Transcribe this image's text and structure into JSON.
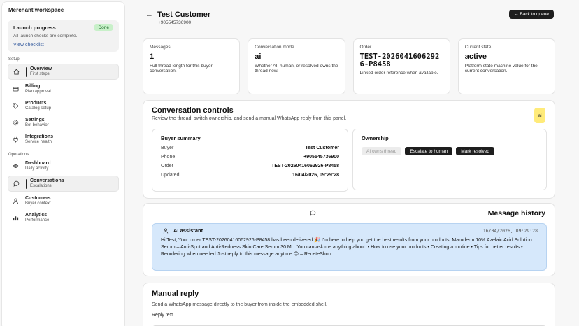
{
  "sidebar": {
    "workspace_title": "Merchant workspace",
    "launch": {
      "title": "Launch progress",
      "badge": "Done",
      "text": "All launch checks are complete.",
      "link": "View checklist"
    },
    "setup_label": "Setup",
    "operations_label": "Operations",
    "setup_items": [
      {
        "label": "Overview",
        "sub": "First steps",
        "icon": "home-icon"
      },
      {
        "label": "Billing",
        "sub": "Plan approval",
        "icon": "card-icon"
      },
      {
        "label": "Products",
        "sub": "Catalog setup",
        "icon": "tag-icon"
      },
      {
        "label": "Settings",
        "sub": "Bot behavior",
        "icon": "gear-icon"
      },
      {
        "label": "Integrations",
        "sub": "Service health",
        "icon": "plug-icon"
      }
    ],
    "operations_items": [
      {
        "label": "Dashboard",
        "sub": "Daily activity",
        "icon": "eye-icon"
      },
      {
        "label": "Conversations",
        "sub": "Escalations",
        "icon": "chat-icon"
      },
      {
        "label": "Customers",
        "sub": "Buyer context",
        "icon": "user-icon"
      },
      {
        "label": "Analytics",
        "sub": "Performance",
        "icon": "bars-icon"
      }
    ]
  },
  "header": {
    "customer_name": "Test Customer",
    "phone": "+905545736900",
    "back_button": "← Back to queue"
  },
  "stats": [
    {
      "label": "Messages",
      "value": "1",
      "desc": "Full thread length for this buyer conversation."
    },
    {
      "label": "Conversation mode",
      "value": "ai",
      "desc": "Whether AI, human, or resolved owns the thread now."
    },
    {
      "label": "Order",
      "value": "TEST-20260416062926-P8458",
      "desc": "Linked order reference when available."
    },
    {
      "label": "Current state",
      "value": "active",
      "desc": "Platform state machine value for the current conversation."
    }
  ],
  "controls": {
    "title": "Conversation controls",
    "subtitle": "Review the thread, switch ownership, and send a manual WhatsApp reply from this panel.",
    "chip": "ai",
    "buyer_summary": {
      "title": "Buyer summary",
      "rows": [
        {
          "key": "Buyer",
          "value": "Test Customer"
        },
        {
          "key": "Phone",
          "value": "+905545736900"
        },
        {
          "key": "Order",
          "value": "TEST-20260416062926-P8458"
        },
        {
          "key": "Updated",
          "value": "16/04/2026, 09:29:28"
        }
      ]
    },
    "ownership": {
      "title": "Ownership",
      "ai_owns": "AI owns thread",
      "escalate": "Escalate to human",
      "resolve": "Mark resolved"
    }
  },
  "history": {
    "title": "Message history",
    "messages": [
      {
        "author": "AI assistant",
        "time": "16/04/2026, 09:29:28",
        "body": "Hi Test, Your order TEST-20260416062926-P8458 has been delivered 🎉 I'm here to help you get the best results from your products: Maruderm 10% Azelaic Acid Solution Serum – Anti-Spot and Anti-Redness Skin Care Serum 30 ML. You can ask me anything about: • How to use your products • Creating a routine • Tips for better results • Reordering when needed Just reply to this message anytime 😊 – ReceteShop"
      }
    ]
  },
  "manual": {
    "title": "Manual reply",
    "subtitle": "Send a WhatsApp message directly to the buyer from inside the embedded shell.",
    "reply_label": "Reply text"
  }
}
